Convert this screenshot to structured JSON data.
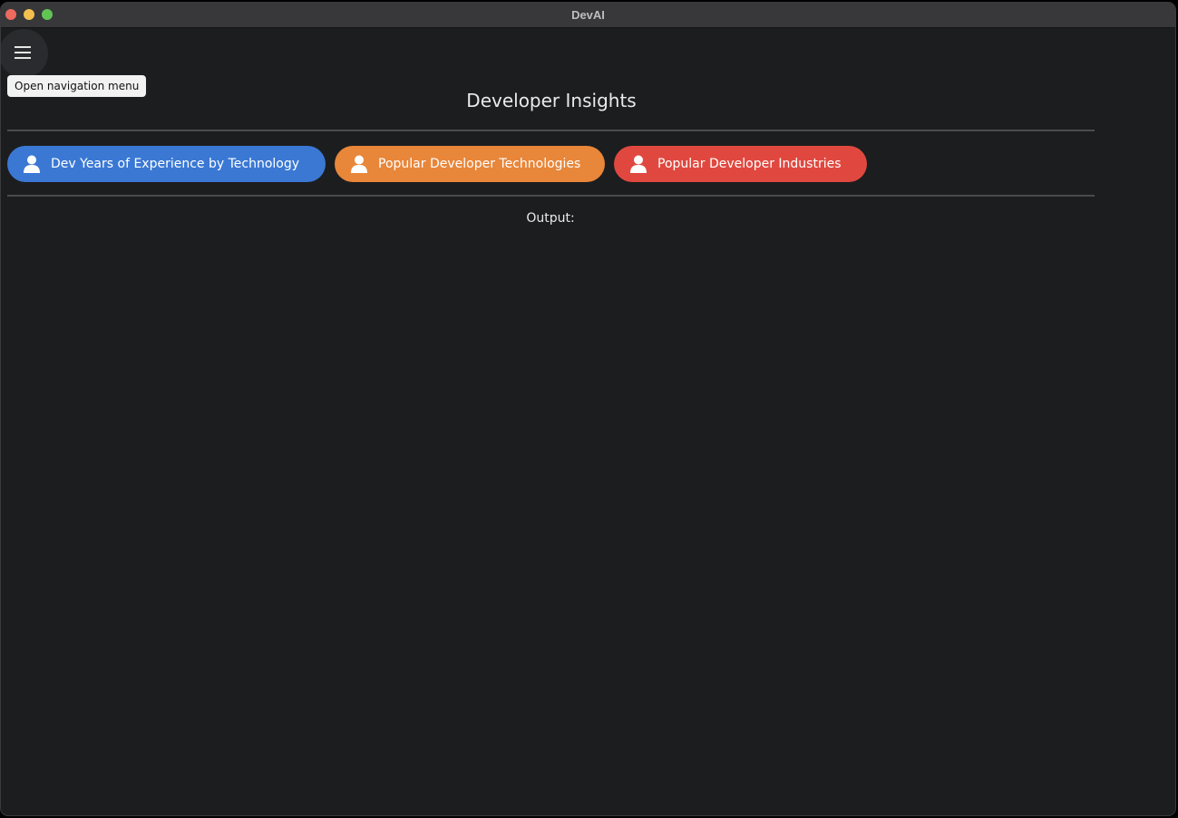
{
  "window": {
    "title": "DevAI"
  },
  "nav": {
    "menu_icon": "hamburger-menu-icon",
    "tooltip": "Open navigation menu"
  },
  "main": {
    "heading": "Developer Insights",
    "buttons": [
      {
        "label": "Dev Years of Experience by Technology",
        "icon": "person-icon",
        "color": "#3a78d4"
      },
      {
        "label": "Popular Developer Technologies",
        "icon": "person-icon",
        "color": "#e8863a"
      },
      {
        "label": "Popular Developer Industries",
        "icon": "person-icon",
        "color": "#e0483f"
      }
    ],
    "output_label": "Output:"
  },
  "colors": {
    "background": "#1c1d1f",
    "titlebar": "#38383a",
    "divider": "#4a4b4e"
  }
}
